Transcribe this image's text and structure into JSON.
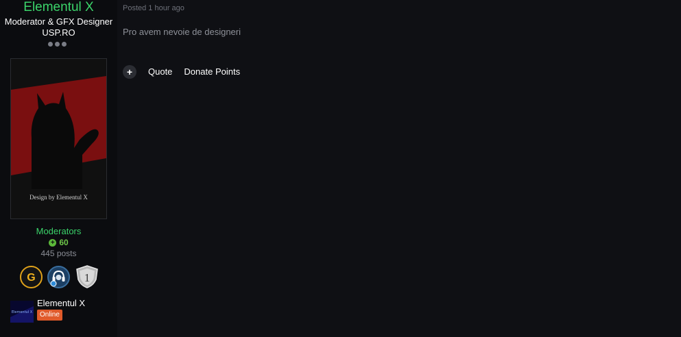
{
  "author": {
    "name": "Elementul X",
    "title": "Moderator & GFX Designer USP.RO",
    "photo_caption": "Design by Elementul X",
    "group": "Moderators",
    "reputation": "60",
    "posts": "445 posts"
  },
  "status": {
    "name": "Elementul X",
    "avatar_text": "Elementul X",
    "online_label": "Online"
  },
  "post": {
    "meta": "Posted 1 hour ago",
    "content": "Pro avem nevoie de designeri"
  },
  "actions": {
    "quote_label": "Quote",
    "donate_label": "Donate Points"
  },
  "badges": [
    {
      "name": "gx-badge-icon"
    },
    {
      "name": "support-headset-badge-icon"
    },
    {
      "name": "rank-1-shield-badge-icon",
      "text": "1"
    }
  ],
  "colors": {
    "accent_green": "#3bd46a",
    "online_orange": "#e05a2a",
    "background": "#0f1014"
  }
}
